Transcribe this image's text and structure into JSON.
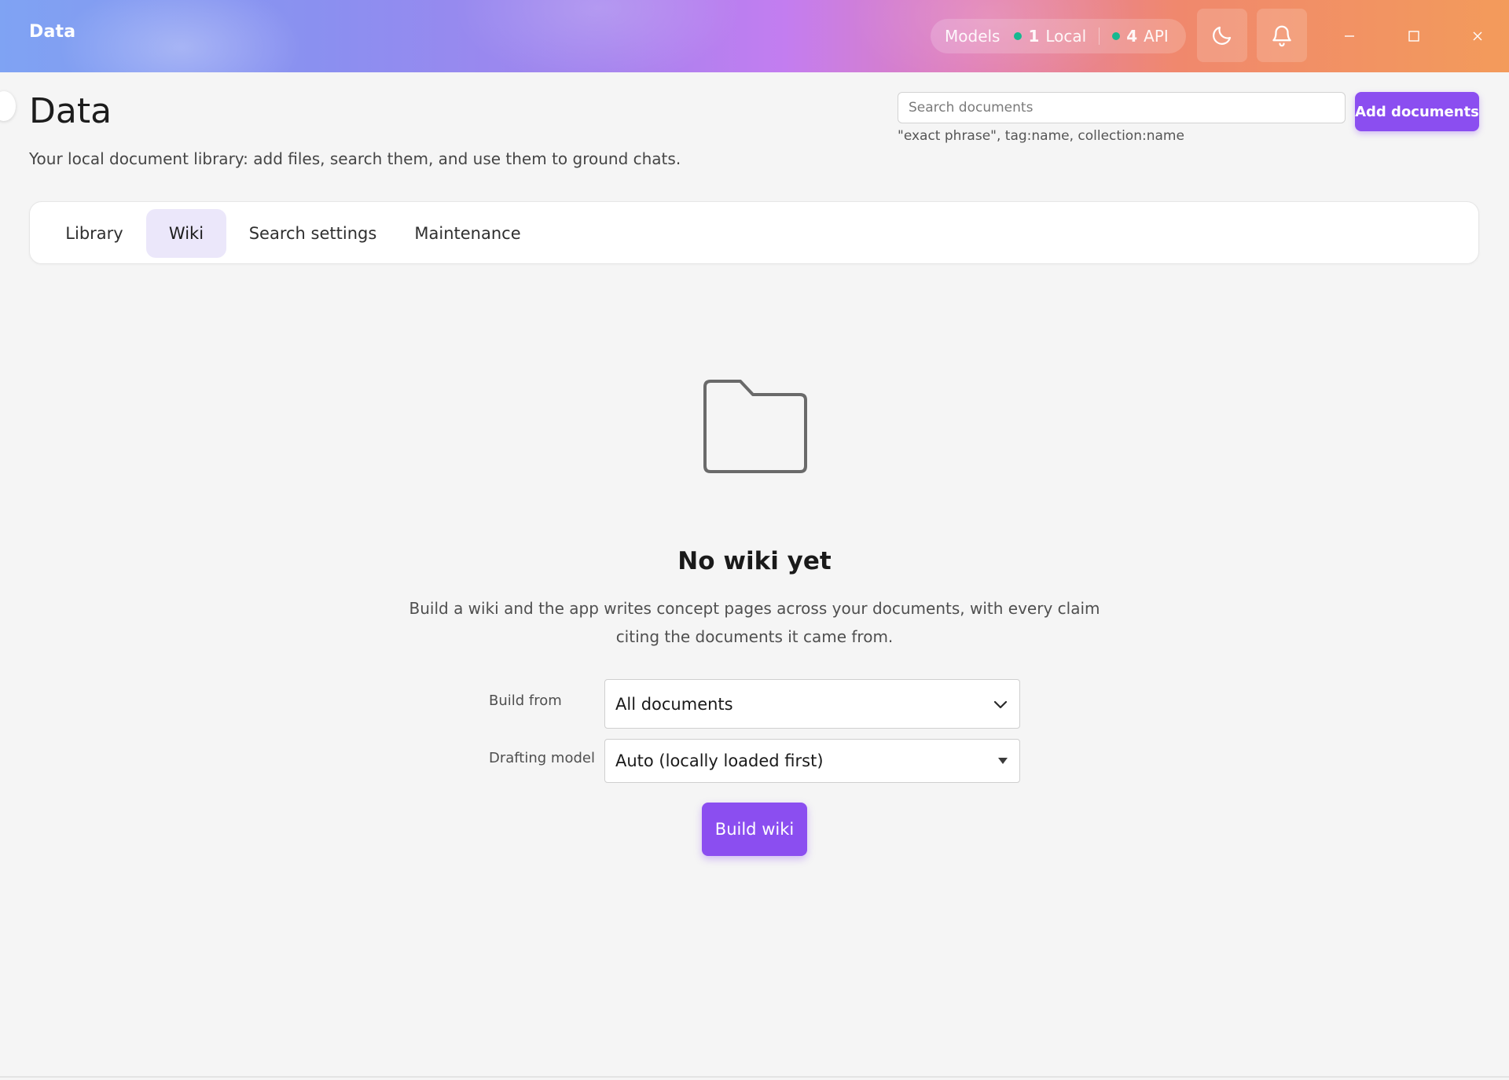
{
  "window": {
    "title": "Data",
    "models_pill": {
      "label": "Models",
      "local_count": "1",
      "local_label": "Local",
      "api_count": "4",
      "api_label": "API",
      "status_color": "#17b890"
    },
    "icons": [
      "moon-icon",
      "bell-icon",
      "minimize-icon",
      "maximize-icon",
      "close-icon"
    ]
  },
  "header": {
    "title": "Data",
    "subtitle": "Your local document library: add files, search them, and use them to ground chats.",
    "search": {
      "placeholder": "Search documents",
      "value": "",
      "hint": "\"exact phrase\", tag:name, collection:name"
    },
    "add_button": "Add documents"
  },
  "tabs": [
    {
      "label": "Library",
      "active": false
    },
    {
      "label": "Wiki",
      "active": true
    },
    {
      "label": "Search settings",
      "active": false
    },
    {
      "label": "Maintenance",
      "active": false
    }
  ],
  "empty_state": {
    "icon": "folder-icon",
    "title": "No wiki yet",
    "description_line1": "Build a wiki and the app writes concept pages across your documents, with every claim",
    "description_line2": "citing the documents it came from."
  },
  "form": {
    "build_from": {
      "label": "Build from",
      "value": "All documents"
    },
    "drafting_model": {
      "label": "Drafting model",
      "value": "Auto (locally loaded first)"
    },
    "build_button": "Build wiki"
  },
  "colors": {
    "accent": "#8b4ef0",
    "active_tab_bg": "#ebe7fa",
    "background": "#f5f5f5"
  }
}
